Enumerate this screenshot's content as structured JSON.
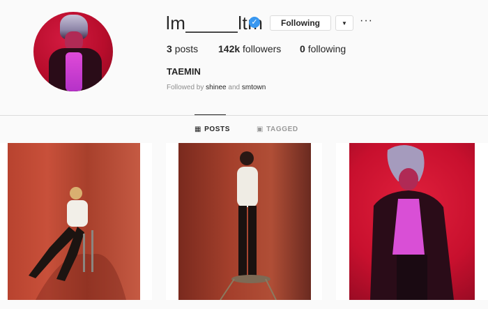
{
  "profile": {
    "username": "lm_____ltm",
    "verified": true,
    "follow_button": "Following",
    "fullname": "TAEMIN",
    "followed_by_prefix": "Followed by",
    "followed_by_user1": "shinee",
    "followed_by_and": "and",
    "followed_by_user2": "smtown"
  },
  "stats": {
    "posts_count": "3",
    "posts_label": "posts",
    "followers_count": "142k",
    "followers_label": "followers",
    "following_count": "0",
    "following_label": "following"
  },
  "tabs": {
    "posts": "POSTS",
    "tagged": "TAGGED"
  },
  "icons": {
    "verified": "verified-badge-icon",
    "dropdown": "chevron-down-icon",
    "more": "more-options-icon",
    "grid": "grid-icon",
    "tagged": "tagged-icon"
  },
  "colors": {
    "accent": "#3897f0",
    "text": "#262626",
    "muted": "#8e8e8e",
    "border": "#dbdbdb"
  }
}
